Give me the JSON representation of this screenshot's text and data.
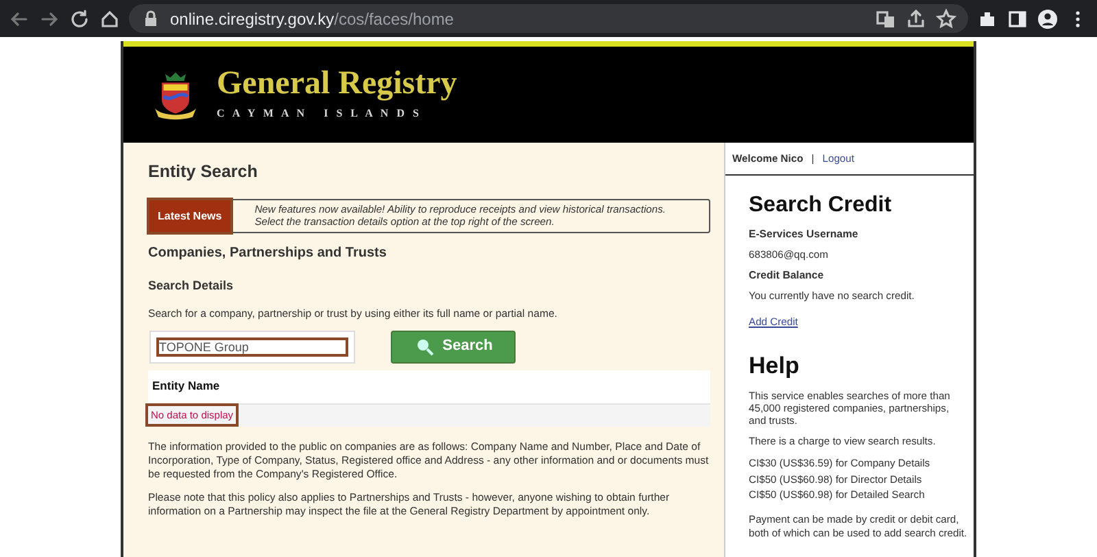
{
  "browser": {
    "host": "online.ciregistry.gov.ky",
    "path": "/cos/faces/home"
  },
  "header": {
    "title": "General Registry",
    "subtitle": "C A Y M A N   I S L A N D S"
  },
  "main": {
    "heading": "Entity Search",
    "news": {
      "label": "Latest News",
      "marked": true,
      "lines": [
        "New features now available! Ability to reproduce receipts and view historical transactions.",
        "Select the transaction details option at the top right of the screen."
      ]
    },
    "section_title": "Companies, Partnerships and Trusts",
    "subsection_title": "Search Details",
    "instructions": "Search for a company, partnership or trust by using either its full name or partial name.",
    "search": {
      "value": "TOPONE Group",
      "marked": true,
      "button": "Search"
    },
    "results": {
      "column": "Entity Name",
      "empty_message": "No data to display",
      "marked": true
    },
    "paragraphs": [
      "The information provided to the public on companies are as follows: Company Name and Number, Place and Date of Incorporation, Type of Company, Status, Registered office and Address - any other information and or documents must be requested from the Company's Registered Office.",
      "Please note that this policy also applies to Partnerships and Trusts - however, anyone wishing to obtain further information on a Partnership may inspect the file at the General Registry Department by appointment only."
    ]
  },
  "sidebar": {
    "welcome": "Welcome Nico",
    "separator": "|",
    "logout": "Logout",
    "credit": {
      "heading": "Search Credit",
      "username_label": "E-Services Username",
      "username": "683806@qq.com",
      "balance_label": "Credit Balance",
      "balance": "You currently have no search credit.",
      "add_credit": "Add Credit"
    },
    "help": {
      "heading": "Help",
      "paragraphs": [
        "This service enables searches of more than 45,000 registered companies, partnerships, and trusts.",
        "There is a charge to view search results."
      ],
      "prices": [
        "CI$30 (US$36.59) for Company Details",
        "CI$50 (US$60.98) for Director Details",
        "CI$50 (US$60.98) for Detailed Search"
      ],
      "payment": "Payment can be made by credit or debit card, both of which can be used to add search credit."
    }
  }
}
